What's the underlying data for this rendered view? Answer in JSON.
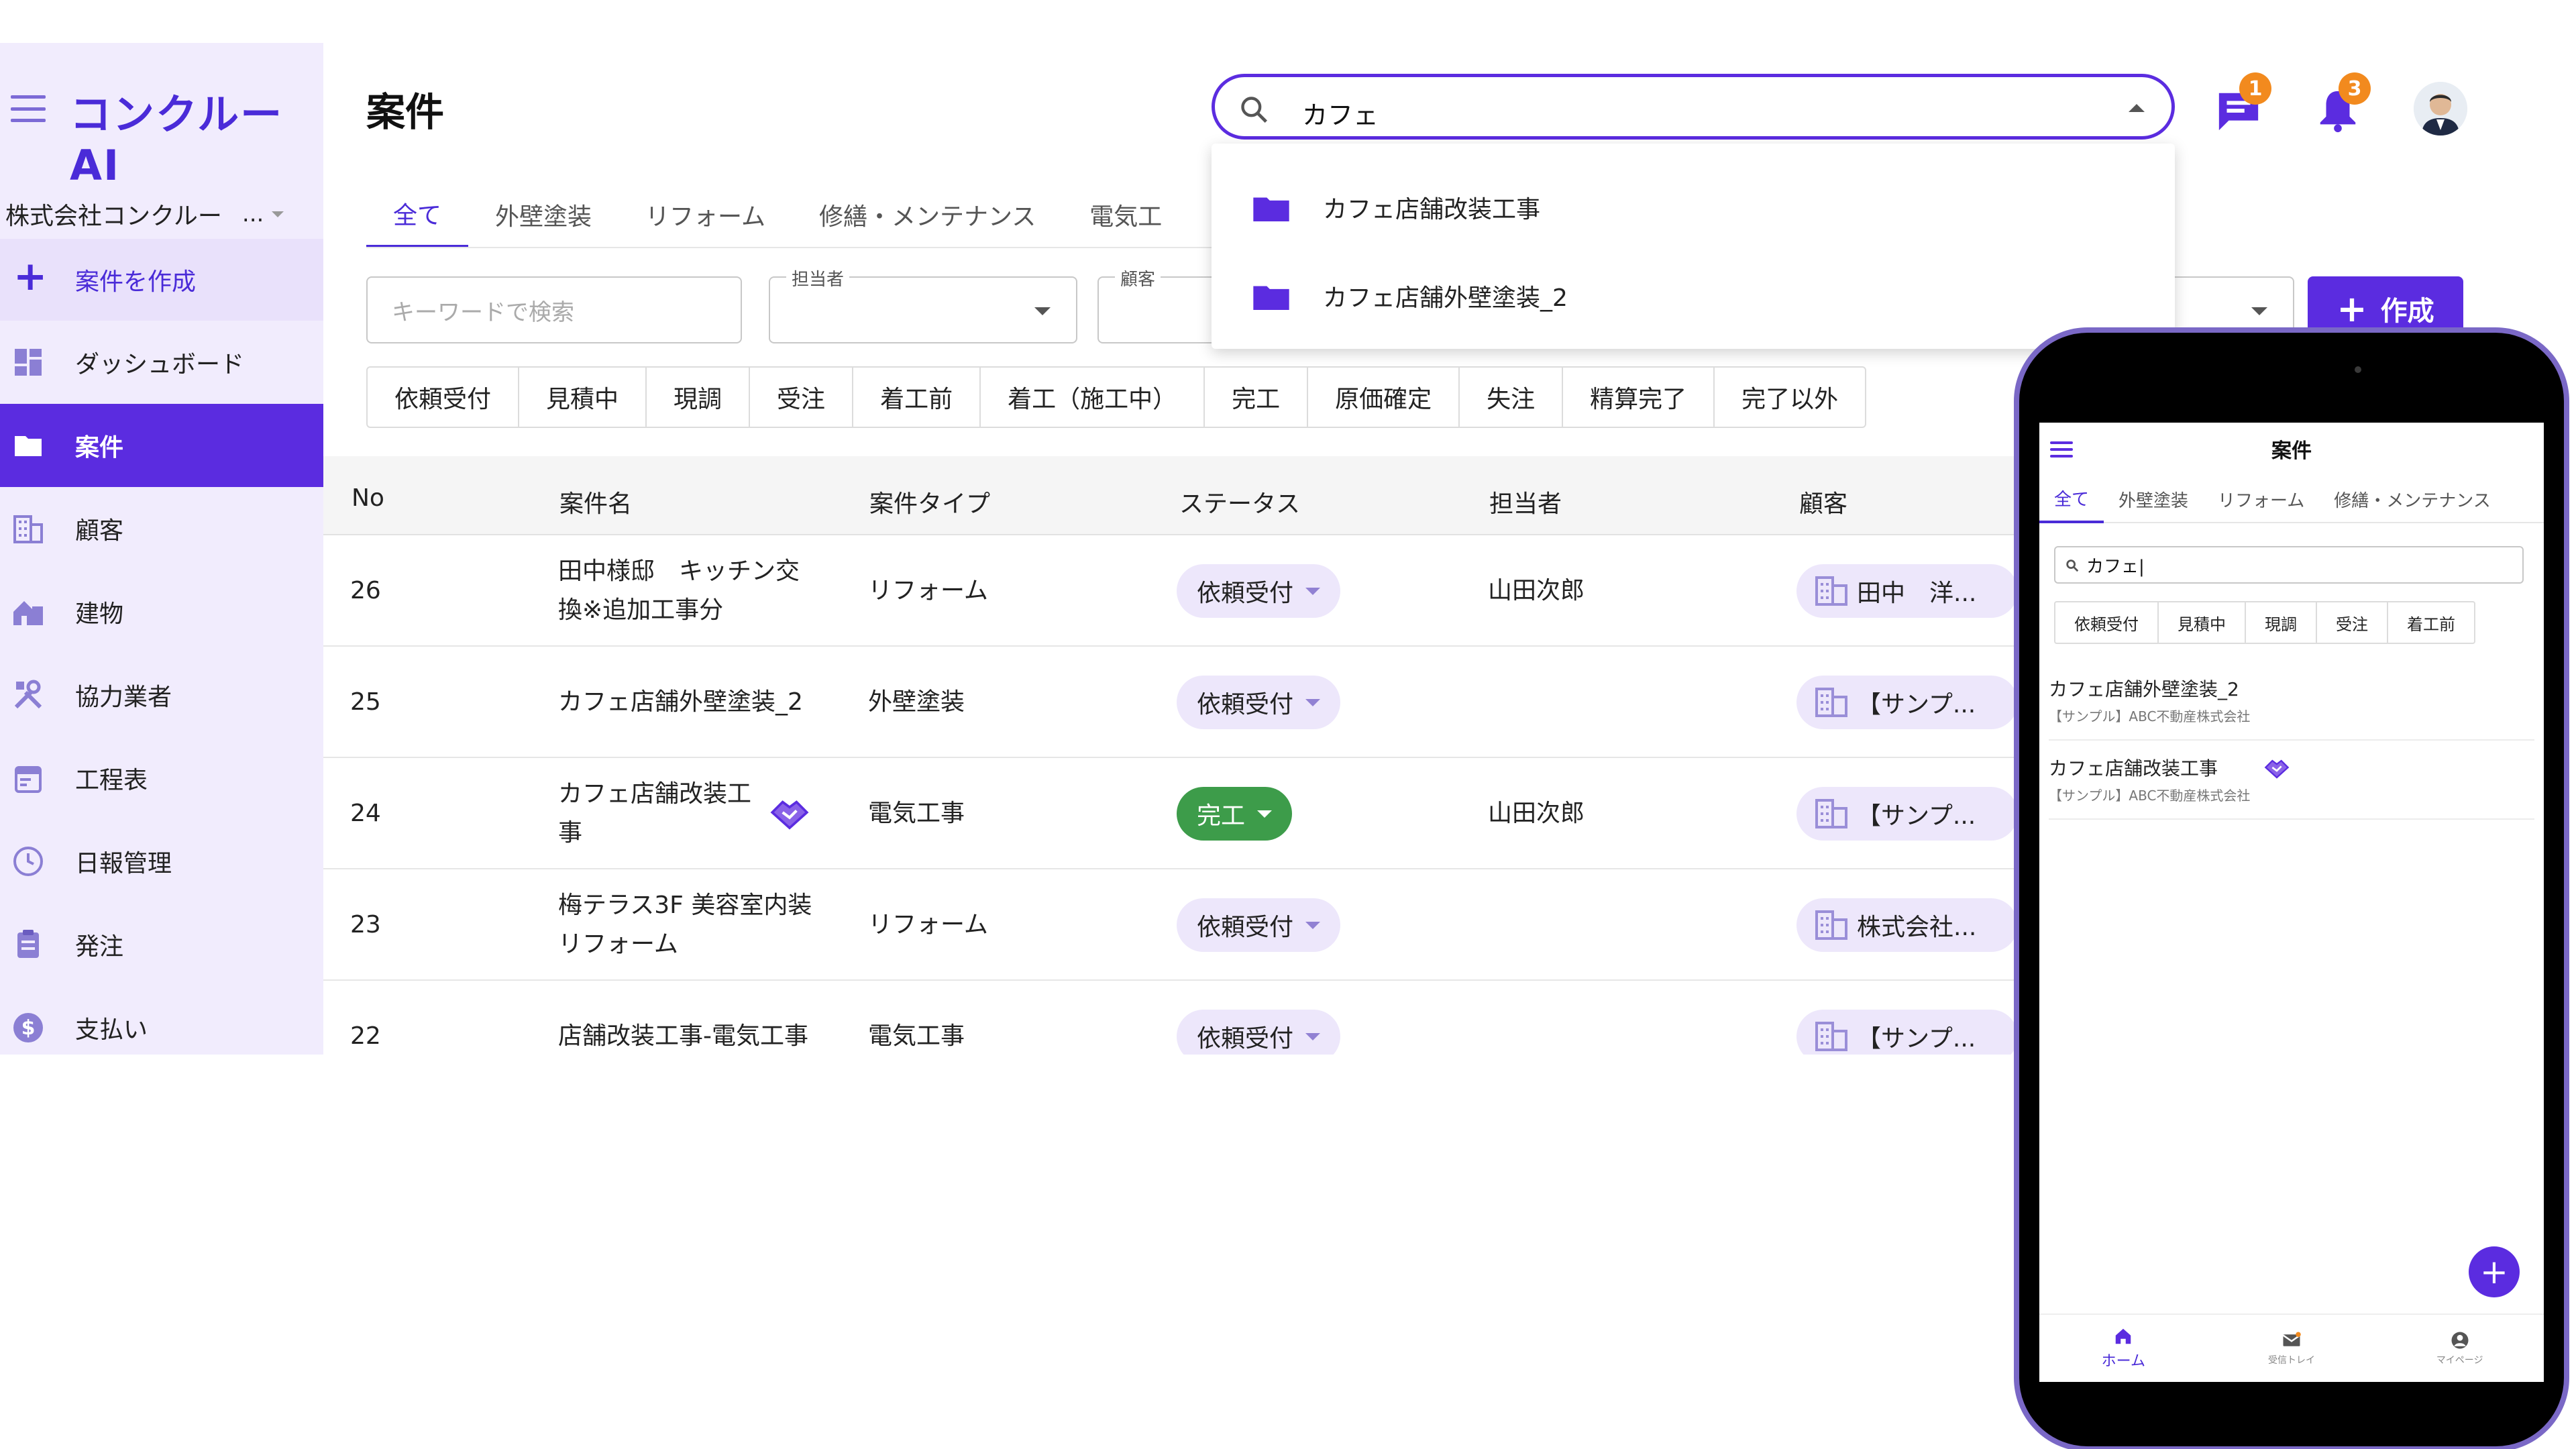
{
  "app": {
    "logo": "コンクルー AI",
    "company": "株式会社コンクルー",
    "company_more": "..."
  },
  "sidebar": {
    "create_label": "案件を作成",
    "items": [
      {
        "label": "ダッシュボード",
        "icon": "dashboard-icon"
      },
      {
        "label": "案件",
        "icon": "folder-icon",
        "active": true
      },
      {
        "label": "顧客",
        "icon": "building-icon"
      },
      {
        "label": "建物",
        "icon": "house-icon"
      },
      {
        "label": "協力業者",
        "icon": "tools-icon"
      },
      {
        "label": "工程表",
        "icon": "calendar-icon"
      },
      {
        "label": "日報管理",
        "icon": "clock-icon"
      },
      {
        "label": "発注",
        "icon": "clipboard-icon"
      },
      {
        "label": "支払い",
        "icon": "dollar-icon"
      }
    ]
  },
  "header": {
    "title": "案件",
    "search_value": "カフェ",
    "messages_badge": "1",
    "notifications_badge": "3"
  },
  "tabs": [
    "全て",
    "外壁塗装",
    "リフォーム",
    "修繕・メンテナンス",
    "電気工"
  ],
  "filters": {
    "keyword_placeholder": "キーワードで検索",
    "assignee_label": "担当者",
    "customer_label": "顧客",
    "create_label": "作成"
  },
  "status_filters": [
    "依頼受付",
    "見積中",
    "現調",
    "受注",
    "着工前",
    "着工（施工中）",
    "完工",
    "原価確定",
    "失注",
    "精算完了",
    "完了以外"
  ],
  "table": {
    "headers": [
      "No",
      "案件名",
      "案件タイプ",
      "ステータス",
      "担当者",
      "顧客"
    ],
    "rows": [
      {
        "no": "26",
        "name1": "田中様邸　キッチン交",
        "name2": "換※追加工事分",
        "type": "リフォーム",
        "status": "依頼受付",
        "assignee": "山田次郎",
        "customer": "田中　洋..."
      },
      {
        "no": "25",
        "name1": "カフェ店舗外壁塗装_2",
        "name2": "",
        "type": "外壁塗装",
        "status": "依頼受付",
        "assignee": "",
        "customer": "【サンプ..."
      },
      {
        "no": "24",
        "name1": "カフェ店舗改装工",
        "name2": "事",
        "type": "電気工事",
        "status": "完工",
        "assignee": "山田次郎",
        "customer": "【サンプ..."
      },
      {
        "no": "23",
        "name1": "梅テラス3F 美容室内装",
        "name2": "リフォーム",
        "type": "リフォーム",
        "status": "依頼受付",
        "assignee": "",
        "customer": "株式会社..."
      },
      {
        "no": "22",
        "name1": "店舗改装工事-電気工事",
        "name2": "",
        "type": "電気工事",
        "status": "依頼受付",
        "assignee": "",
        "customer": "【サンプ..."
      }
    ]
  },
  "dropdown": {
    "items": [
      "カフェ店舗改装工事",
      "カフェ店舗外壁塗装_2"
    ]
  },
  "phone": {
    "title": "案件",
    "tabs": [
      "全て",
      "外壁塗装",
      "リフォーム",
      "修繕・メンテナンス"
    ],
    "search_value": "カフェ|",
    "status_filters": [
      "依頼受付",
      "見積中",
      "現調",
      "受注",
      "着工前"
    ],
    "results": [
      {
        "title": "カフェ店舗外壁塗装_2",
        "sub": "【サンプル】ABC不動産株式会社"
      },
      {
        "title": "カフェ店舗改装工事",
        "sub": "【サンプル】ABC不動産株式会社"
      }
    ],
    "bottom_nav": [
      "ホーム",
      "受信トレイ",
      "マイページ"
    ]
  },
  "colors": {
    "accent": "#5b2ce0",
    "sidebar_bg": "#f1ecfd",
    "chip_bg": "#ede7fb",
    "done_green": "#3d9c4a",
    "badge_orange": "#f28a1e"
  }
}
